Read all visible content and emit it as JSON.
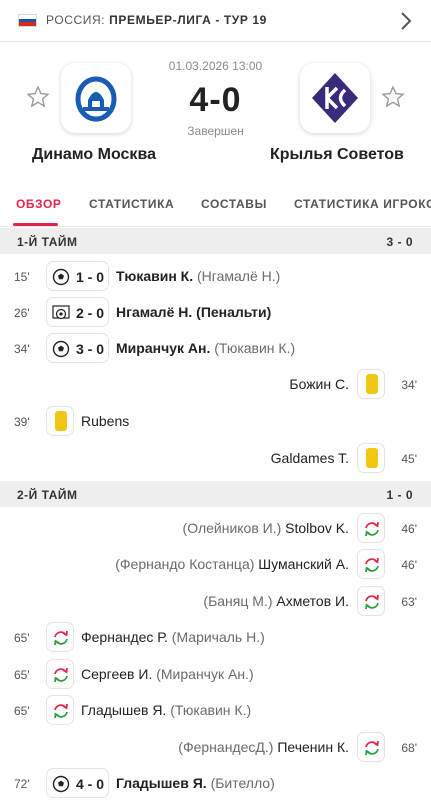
{
  "header": {
    "country": "РОССИЯ:",
    "competition": "ПРЕМЬЕР-ЛИГА - ТУР 19",
    "flag_colors": [
      "#ffffff",
      "#1c57a5",
      "#d52b1e"
    ]
  },
  "match": {
    "datetime": "01.03.2026 13:00",
    "score": "4-0",
    "status": "Завершен",
    "home": {
      "name": "Динамо Москва",
      "logo": "dynamo-logo",
      "color": "#1a5bb5"
    },
    "away": {
      "name": "Крылья Советов",
      "logo": "krylia-logo",
      "color": "#3a2a7a"
    }
  },
  "tabs": [
    "ОБЗОР",
    "СТАТИСТИКА",
    "СОСТАВЫ",
    "СТАТИСТИКА ИГРОКО"
  ],
  "colors": {
    "accent": "#e4264c",
    "yellow_card": "#f2c713",
    "sub_in": "#2f9e44",
    "sub_out": "#e4264c"
  },
  "halves": [
    {
      "label": "1-Й ТАЙМ",
      "score": "3 - 0"
    },
    {
      "label": "2-Й ТАЙМ",
      "score": "1 - 0"
    }
  ],
  "events": [
    {
      "minute": "15'",
      "type": "goal",
      "icon": "football-icon",
      "score": "1 - 0",
      "player": "Тюкавин К.",
      "assist": "(Нгамалё Н.)"
    },
    {
      "minute": "26'",
      "type": "penalty",
      "icon": "penalty-icon",
      "score": "2 - 0",
      "player": "Нгамалё Н.",
      "assist": "(Пенальти)"
    },
    {
      "minute": "34'",
      "type": "goal",
      "icon": "football-icon",
      "score": "3 - 0",
      "player": "Миранчук Ан.",
      "assist": "(Тюкавин К.)"
    },
    {
      "minute": "34'",
      "type": "yellow",
      "icon": "yellow-card-icon",
      "player": "Божин С."
    },
    {
      "minute": "39'",
      "type": "yellow",
      "icon": "yellow-card-icon",
      "player": "Rubens"
    },
    {
      "minute": "45'",
      "type": "yellow",
      "icon": "yellow-card-icon",
      "player": "Galdames T."
    },
    {
      "minute": "46'",
      "type": "sub",
      "icon": "substitution-icon",
      "player": "Stolbov K.",
      "assist": "(Олейников И.)"
    },
    {
      "minute": "46'",
      "type": "sub",
      "icon": "substitution-icon",
      "player": "Шуманский А.",
      "assist": "(Фернандо Костанца)"
    },
    {
      "minute": "63'",
      "type": "sub",
      "icon": "substitution-icon",
      "player": "Ахметов И.",
      "assist": "(Баняц М.)"
    },
    {
      "minute": "65'",
      "type": "sub",
      "icon": "substitution-icon",
      "player": "Фернандес Р.",
      "assist": "(Маричаль Н.)"
    },
    {
      "minute": "65'",
      "type": "sub",
      "icon": "substitution-icon",
      "player": "Сергеев И.",
      "assist": "(Миранчук Ан.)"
    },
    {
      "minute": "65'",
      "type": "sub",
      "icon": "substitution-icon",
      "player": "Гладышев Я.",
      "assist": "(Тюкавин К.)"
    },
    {
      "minute": "68'",
      "type": "sub",
      "icon": "substitution-icon",
      "player": "Печенин К.",
      "assist": "(ФернандесД.)"
    },
    {
      "minute": "72'",
      "type": "goal",
      "icon": "football-icon",
      "score": "4 - 0",
      "player": "Гладышев Я.",
      "assist": "(Бителло)"
    }
  ]
}
